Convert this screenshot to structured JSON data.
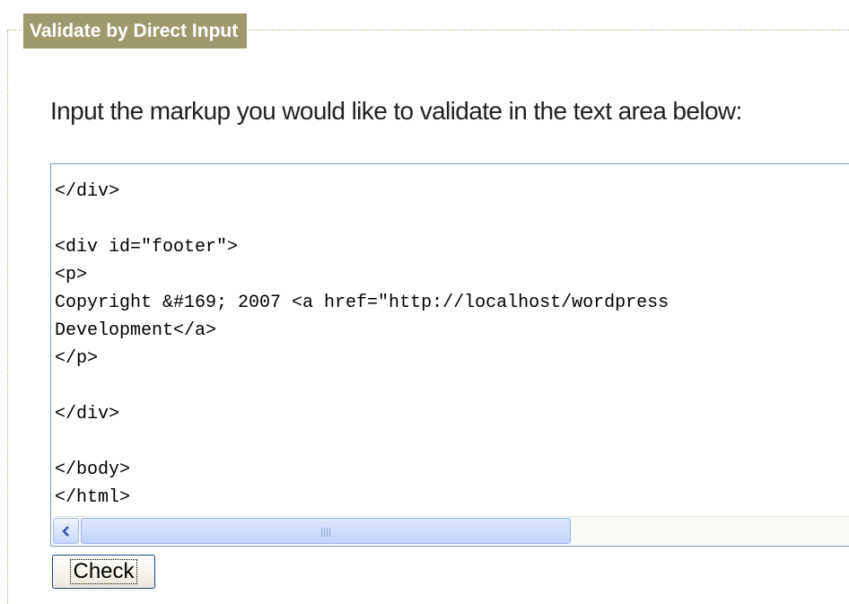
{
  "fieldset": {
    "legend": "Validate by Direct Input"
  },
  "instruction": "Input the markup you would like to validate in the text area below:",
  "textarea": {
    "value": "</div>\n\n<div id=\"footer\">\n<p>\nCopyright &#169; 2007 <a href=\"http://localhost/wordpress\nDevelopment</a>\n</p>\n\n</div>\n\n</body>\n</html>"
  },
  "scrollbar": {
    "left_arrow_icon": "chevron-left-icon",
    "grip_icon": "grip-icon"
  },
  "check_button": {
    "label": "Check"
  },
  "colors": {
    "legend_bg": "#9f9a6d",
    "legend_text": "#ffffff",
    "textarea_border": "#7f9db9",
    "button_border": "#1c3f94"
  }
}
